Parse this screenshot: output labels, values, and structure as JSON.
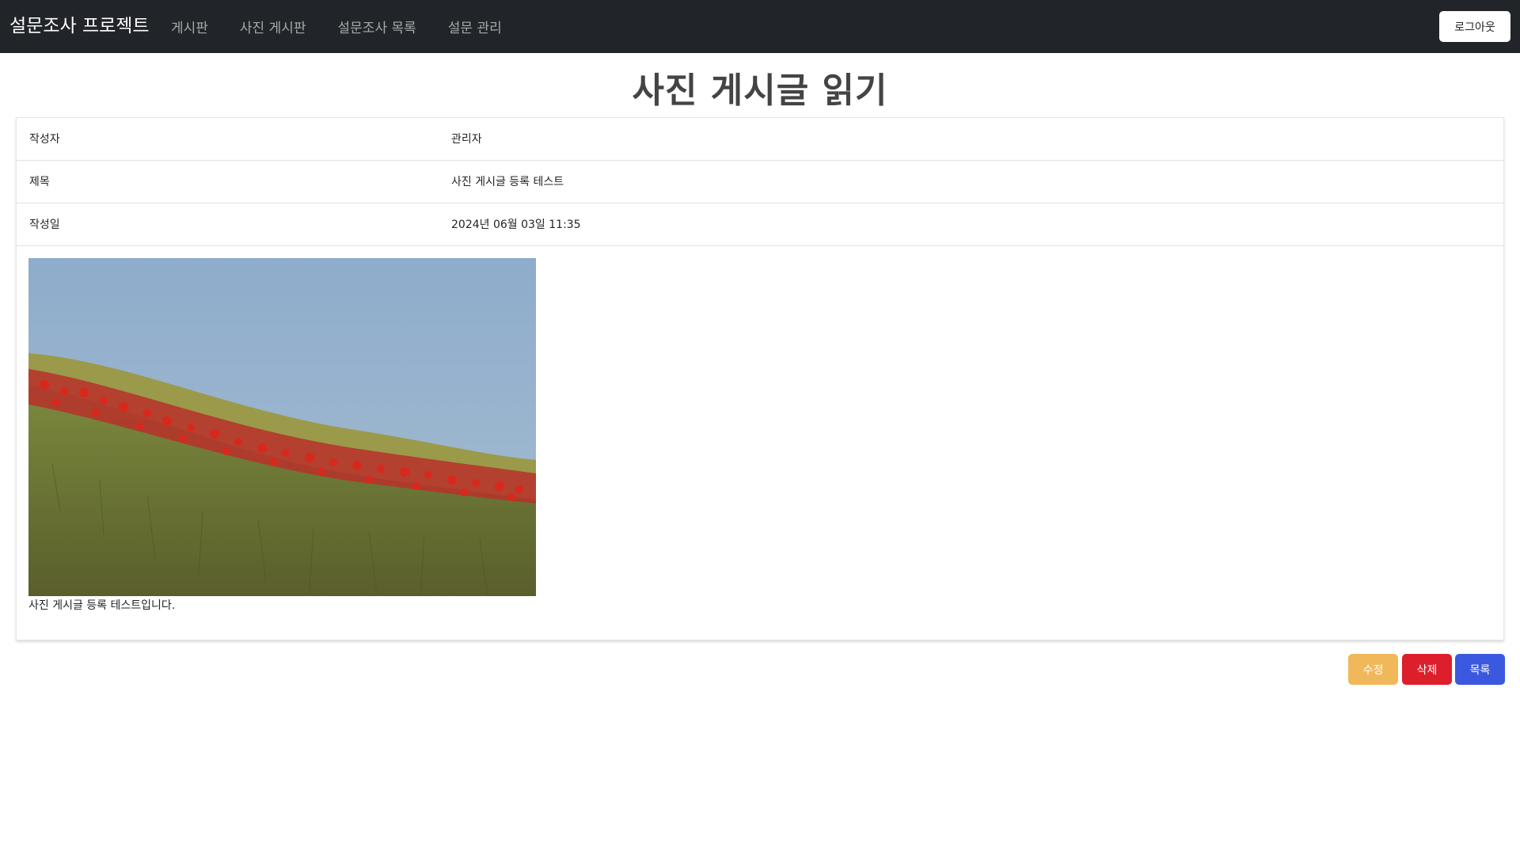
{
  "navbar": {
    "brand": "설문조사 프로젝트",
    "links": [
      "게시판",
      "사진 게시판",
      "설문조사 목록",
      "설문 관리"
    ],
    "logout_label": "로그아웃"
  },
  "page": {
    "title": "사진 게시글 읽기"
  },
  "post": {
    "rows": [
      {
        "label": "작성자",
        "value": "관리자"
      },
      {
        "label": "제목",
        "value": "사진 게시글 등록 테스트"
      },
      {
        "label": "작성일",
        "value": "2024년 06월 03일 11:35"
      }
    ],
    "photo_icon": "poppy-field-photo",
    "content": "사진 게시글 등록 테스트입니다."
  },
  "actions": {
    "edit_label": "수정",
    "delete_label": "삭제",
    "list_label": "목록"
  },
  "colors": {
    "navbar_bg": "#212529",
    "edit": "#f0b85a",
    "delete": "#dc1f2b",
    "list": "#3a58e0"
  }
}
